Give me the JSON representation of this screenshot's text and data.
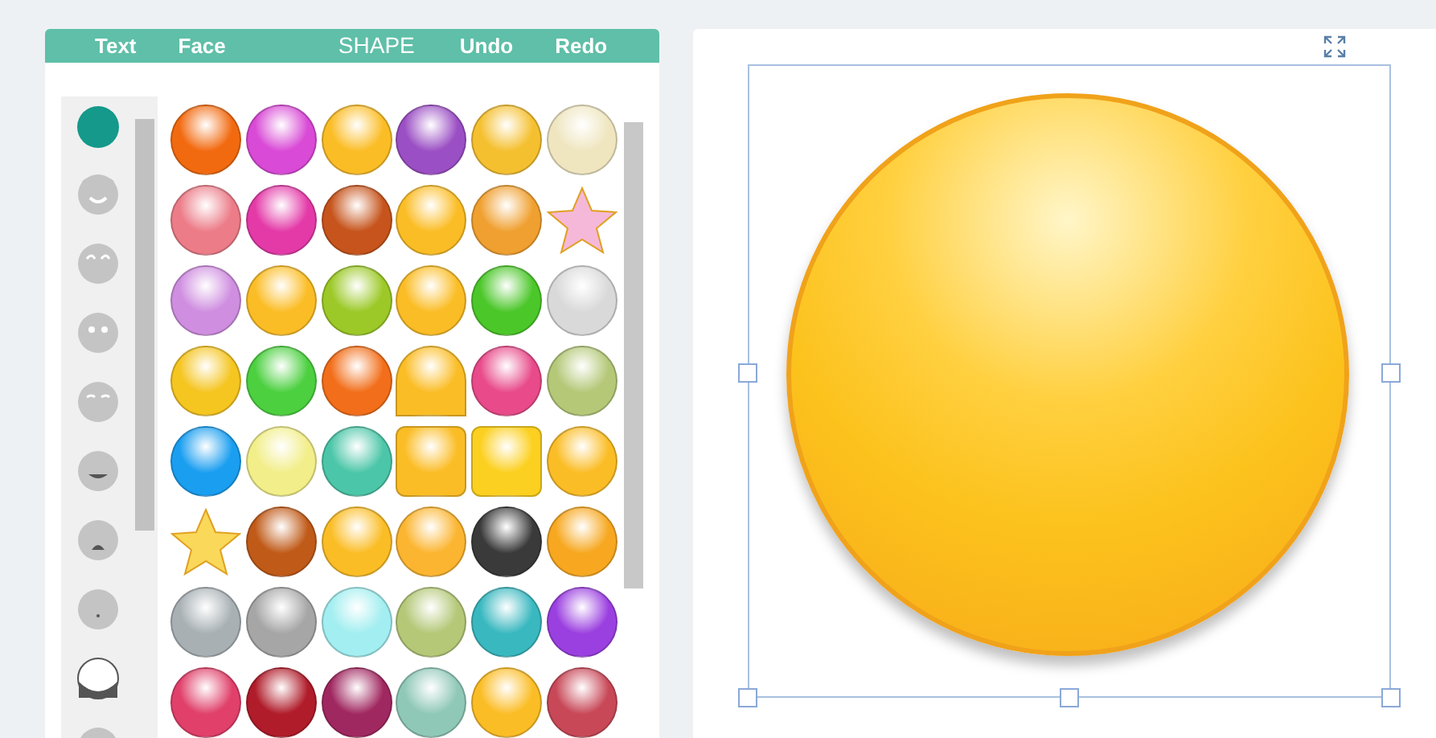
{
  "toolbar": {
    "tabs": [
      {
        "label": "Text",
        "selected": false
      },
      {
        "label": "Face",
        "selected": false
      },
      {
        "label": "SHAPE",
        "selected": true
      }
    ],
    "actions": [
      {
        "label": "Undo"
      },
      {
        "label": "Redo"
      }
    ]
  },
  "categories": [
    {
      "kind": "color",
      "selected": true
    },
    {
      "kind": "devil",
      "selected": false
    },
    {
      "kind": "happy",
      "selected": false
    },
    {
      "kind": "eyes",
      "selected": false
    },
    {
      "kind": "sleepy",
      "selected": false
    },
    {
      "kind": "smile",
      "selected": false
    },
    {
      "kind": "sad",
      "selected": false
    },
    {
      "kind": "small",
      "selected": false
    },
    {
      "kind": "beard",
      "selected": false
    },
    {
      "kind": "plain",
      "selected": false
    }
  ],
  "shapes": [
    {
      "kind": "circle",
      "color": "#f26a10"
    },
    {
      "kind": "circle",
      "color": "#d94ad6"
    },
    {
      "kind": "circle",
      "color": "#fbbd26"
    },
    {
      "kind": "circle",
      "color": "#9b4fc4"
    },
    {
      "kind": "circle",
      "color": "#f5c030"
    },
    {
      "kind": "circle",
      "color": "#efe6c0"
    },
    {
      "kind": "circle",
      "color": "#ec7c88"
    },
    {
      "kind": "circle",
      "color": "#e43aa8"
    },
    {
      "kind": "circle",
      "color": "#c6541c"
    },
    {
      "kind": "circle",
      "color": "#fbbd26"
    },
    {
      "kind": "circle",
      "color": "#f0a030"
    },
    {
      "kind": "star",
      "color": "#f5b8d8"
    },
    {
      "kind": "circle",
      "color": "#cf8ee0"
    },
    {
      "kind": "circle",
      "color": "#fbbd26"
    },
    {
      "kind": "circle",
      "color": "#9cc928"
    },
    {
      "kind": "circle",
      "color": "#fbbd26"
    },
    {
      "kind": "circle",
      "color": "#4cc72a"
    },
    {
      "kind": "circle",
      "color": "#d9d9d9"
    },
    {
      "kind": "circle",
      "color": "#f5c520"
    },
    {
      "kind": "circle",
      "color": "#4cd040"
    },
    {
      "kind": "circle",
      "color": "#f26e1a"
    },
    {
      "kind": "dome",
      "color": "#fbbd26"
    },
    {
      "kind": "circle",
      "color": "#e84a8a"
    },
    {
      "kind": "circle",
      "color": "#b4c878"
    },
    {
      "kind": "circle",
      "color": "#1a9ef0"
    },
    {
      "kind": "circle",
      "color": "#f2ee8a"
    },
    {
      "kind": "circle",
      "color": "#4cc6a8"
    },
    {
      "kind": "square",
      "color": "#fbbd26"
    },
    {
      "kind": "square",
      "color": "#fcd020"
    },
    {
      "kind": "circle",
      "color": "#fbbd26"
    },
    {
      "kind": "star",
      "color": "#f9d85a"
    },
    {
      "kind": "circle",
      "color": "#c05a18"
    },
    {
      "kind": "circle",
      "color": "#fbbd26"
    },
    {
      "kind": "circle",
      "color": "#fbb530"
    },
    {
      "kind": "circle",
      "color": "#3a3a3a"
    },
    {
      "kind": "circle",
      "color": "#f7a820"
    },
    {
      "kind": "circle",
      "color": "#a8b0b4"
    },
    {
      "kind": "circle",
      "color": "#a6a6a6"
    },
    {
      "kind": "circle",
      "color": "#a2eef0"
    },
    {
      "kind": "circle",
      "color": "#b4c878"
    },
    {
      "kind": "circle",
      "color": "#3ab8c0"
    },
    {
      "kind": "circle",
      "color": "#9b40e0"
    },
    {
      "kind": "circle",
      "color": "#e0406a"
    },
    {
      "kind": "circle",
      "color": "#b01c2a"
    },
    {
      "kind": "circle",
      "color": "#a02860"
    },
    {
      "kind": "circle",
      "color": "#90c8b8"
    },
    {
      "kind": "circle",
      "color": "#fbbd26"
    },
    {
      "kind": "circle",
      "color": "#c84858"
    }
  ]
}
